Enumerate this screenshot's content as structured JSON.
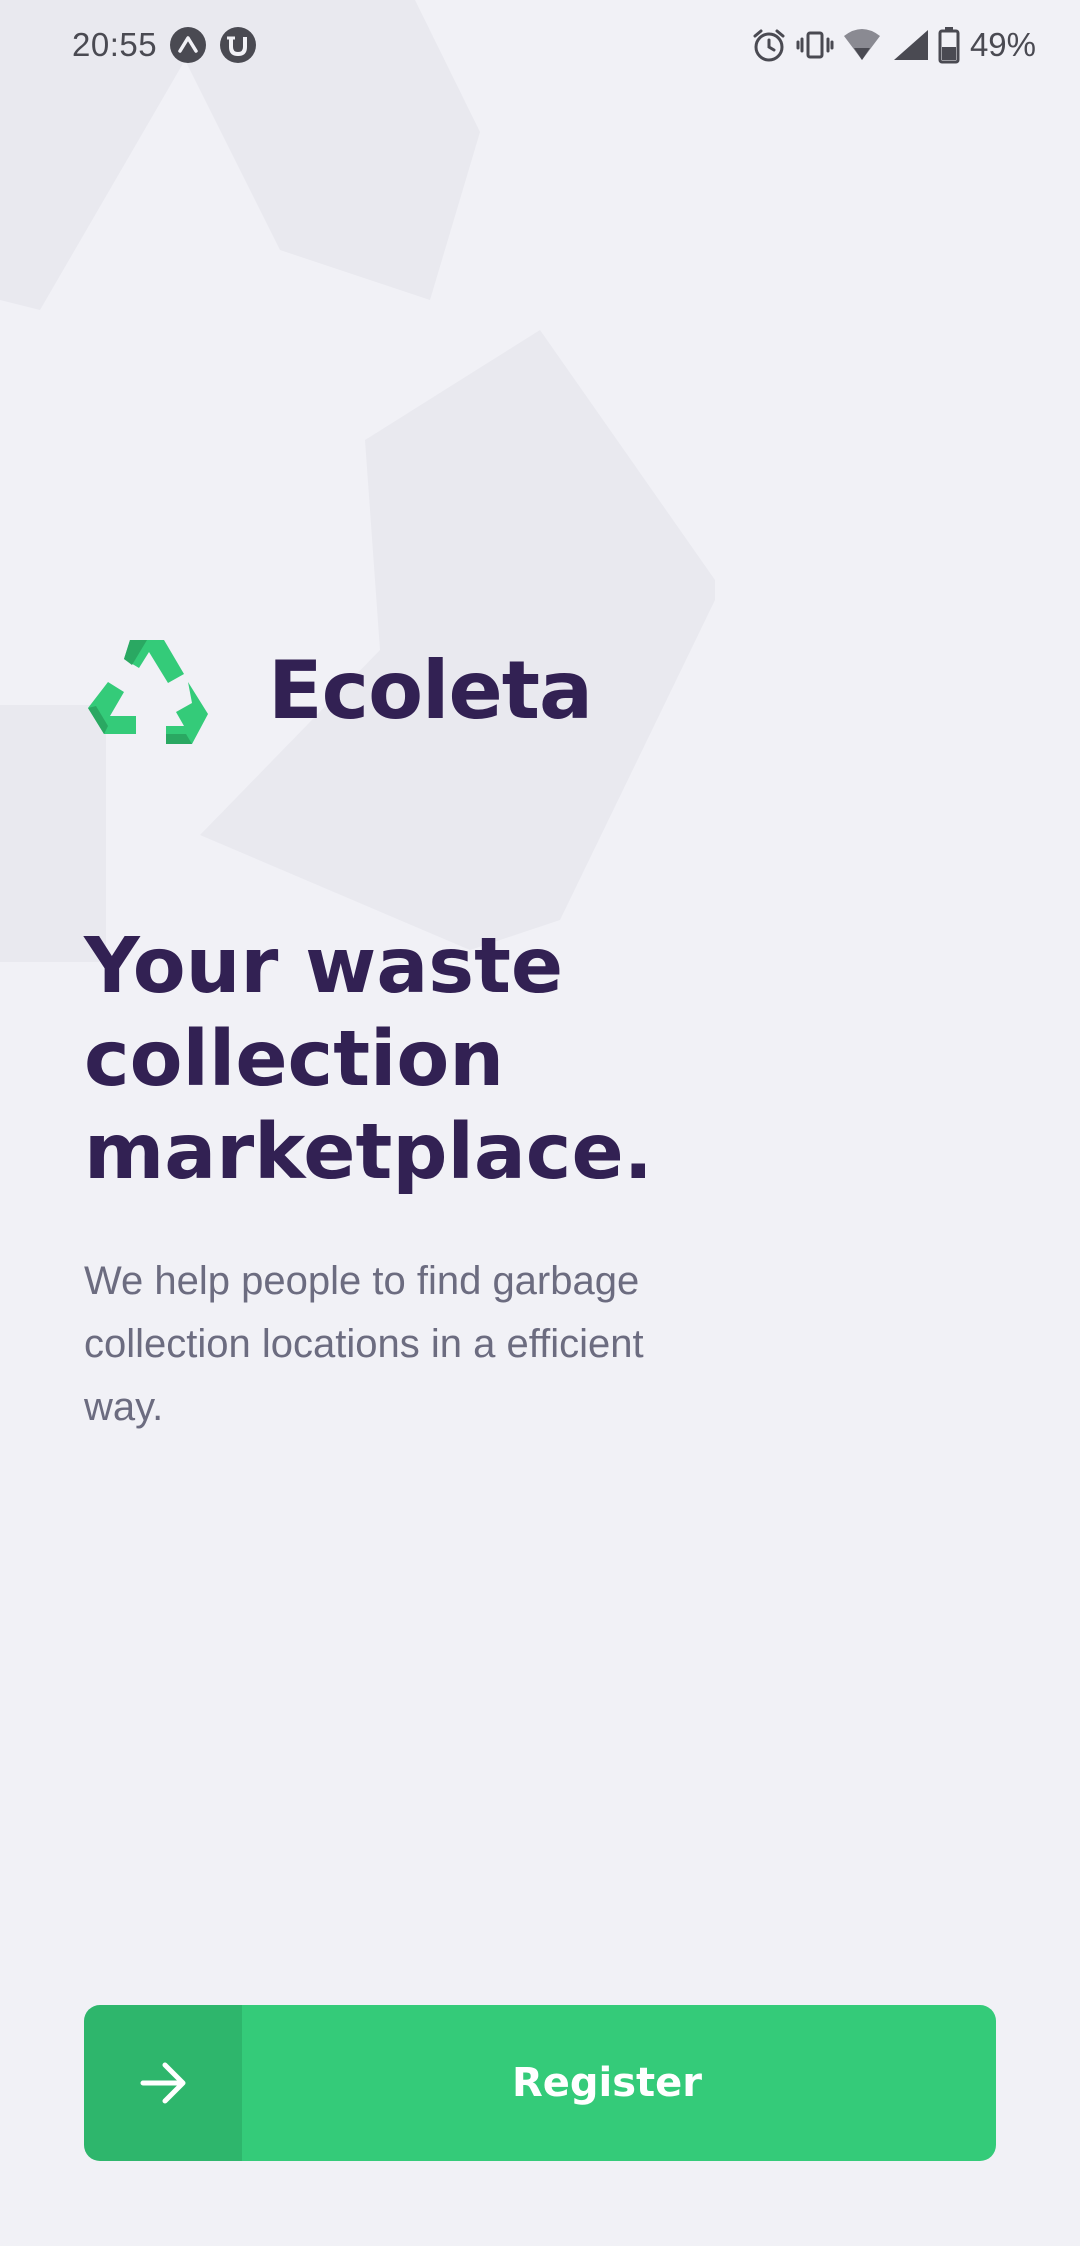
{
  "status_bar": {
    "time": "20:55",
    "battery_percent": "49%",
    "left_icons": [
      "caret-up-badge-icon",
      "utorrent-icon"
    ],
    "right_icons": [
      "alarm-icon",
      "vibrate-icon",
      "wifi-icon",
      "signal-icon",
      "battery-icon"
    ]
  },
  "app": {
    "name": "Ecoleta",
    "logo_icon": "recycle-icon"
  },
  "hero": {
    "title_lines": [
      "Your waste",
      "collection",
      "marketplace."
    ],
    "description": "We help people to find garbage collection locations in a efficient way."
  },
  "register_button": {
    "label": "Register",
    "icon": "arrow-right-icon"
  },
  "colors": {
    "background": "#f1f1f6",
    "primary": "#34cb79",
    "title": "#322153",
    "text": "#6c6c80",
    "button_text": "#ffffff"
  }
}
